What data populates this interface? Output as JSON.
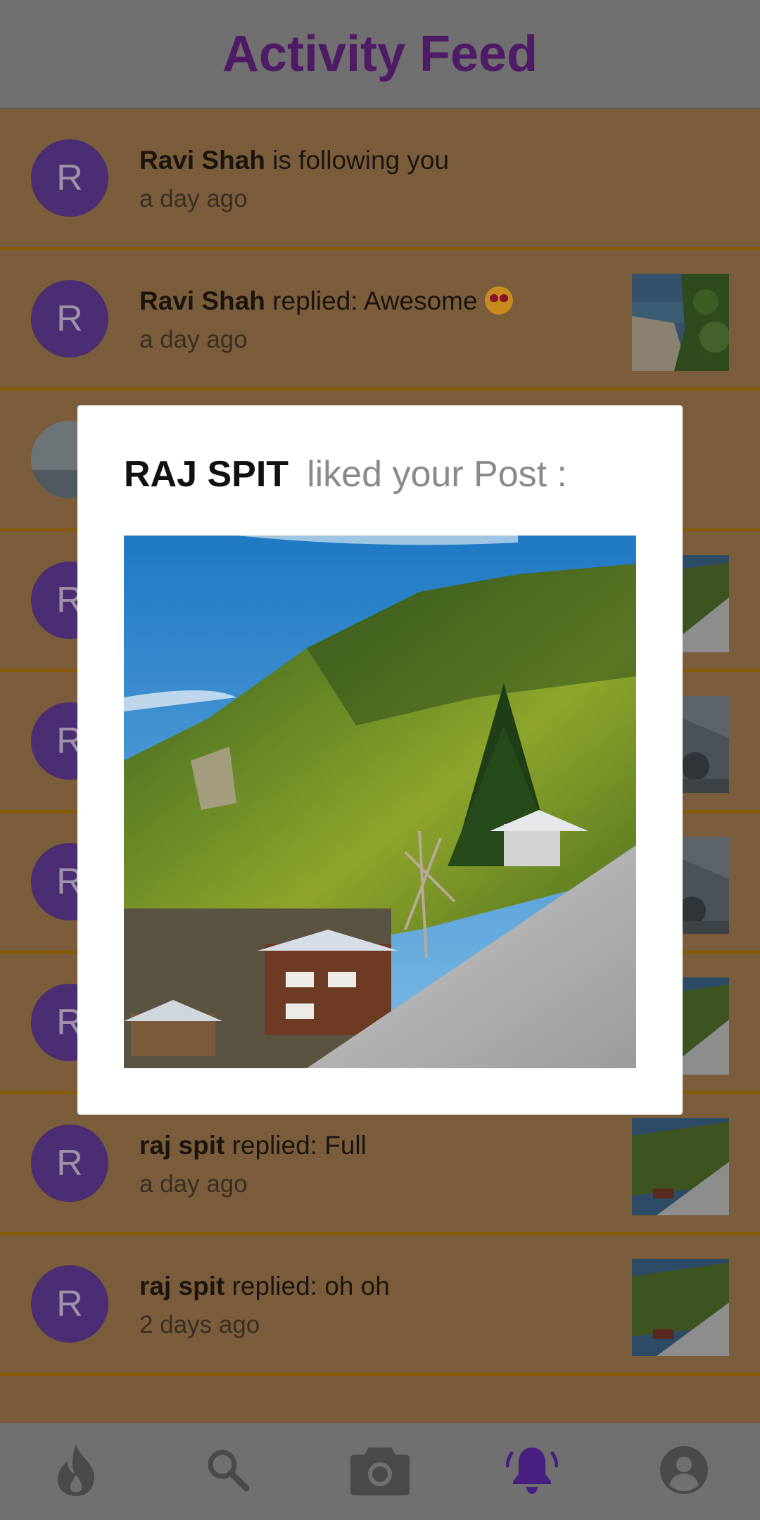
{
  "header": {
    "title": "Activity Feed"
  },
  "feed": [
    {
      "avatar_letter": "R",
      "username": "Ravi Shah",
      "action": " is following you",
      "time": "a day ago",
      "has_thumb": false
    },
    {
      "avatar_letter": "R",
      "username": "Ravi Shah",
      "action": " replied: Awesome ",
      "emoji": "heart-eyes-emoji",
      "time": "a day ago",
      "has_thumb": true,
      "thumb": "beach"
    },
    {
      "avatar_letter": "",
      "username": "",
      "action": "",
      "time": "",
      "has_thumb": false,
      "thumb": "photo-avatar"
    },
    {
      "avatar_letter": "R",
      "username": "",
      "action": "",
      "time": "",
      "has_thumb": true,
      "thumb": "mountain"
    },
    {
      "avatar_letter": "R",
      "username": "",
      "action": "",
      "time": "",
      "has_thumb": true,
      "thumb": "dark-tree"
    },
    {
      "avatar_letter": "R",
      "username": "",
      "action": "",
      "time": "",
      "has_thumb": true,
      "thumb": "dark-tree"
    },
    {
      "avatar_letter": "R",
      "username": "",
      "action": "",
      "time": "",
      "has_thumb": true,
      "thumb": "mountain"
    },
    {
      "avatar_letter": "R",
      "username": "raj spit",
      "action": " replied: Full",
      "time": "a day ago",
      "has_thumb": true,
      "thumb": "mountain"
    },
    {
      "avatar_letter": "R",
      "username": "raj spit",
      "action": " replied: oh oh",
      "time": "2 days ago",
      "has_thumb": true,
      "thumb": "mountain"
    }
  ],
  "modal": {
    "username": "RAJ SPIT",
    "action": "liked your Post :"
  },
  "nav": [
    {
      "icon": "flame-icon",
      "active": false
    },
    {
      "icon": "search-icon",
      "active": false
    },
    {
      "icon": "camera-icon",
      "active": false
    },
    {
      "icon": "bell-icon",
      "active": true
    },
    {
      "icon": "account-icon",
      "active": false
    }
  ],
  "colors": {
    "accent": "#4f1a66",
    "active_nav": "#4a1f82",
    "row_bg": "#7b5d3b",
    "divider": "#8a5a00"
  }
}
